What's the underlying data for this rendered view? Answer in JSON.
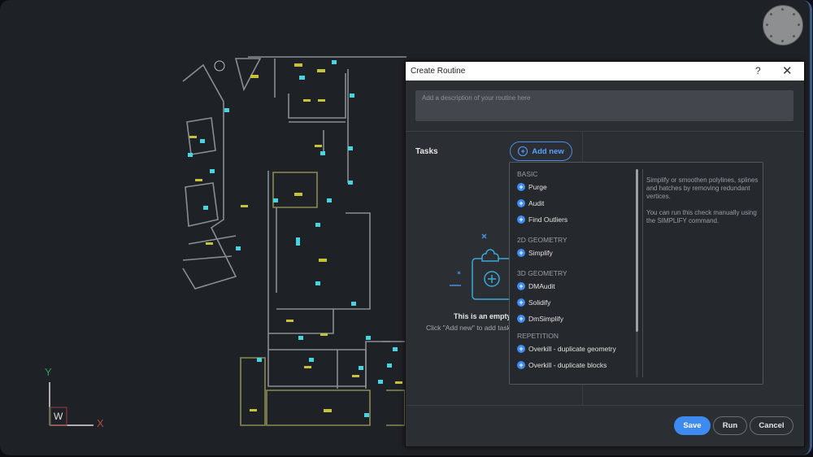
{
  "canvas": {
    "ucs": {
      "y_label": "Y",
      "x_label": "X",
      "w_label": "W"
    },
    "colors": {
      "background": "#1e2126",
      "walls": "#9a9da2",
      "labels": "#c8c23a",
      "symbols": "#46d4e0"
    }
  },
  "dialog": {
    "title": "Create Routine",
    "help_label": "?",
    "close_label": "✕",
    "description_placeholder": "Add a description of your routine here",
    "tasks_label": "Tasks",
    "add_new_label": "Add new",
    "empty_title": "This is an empty",
    "empty_subtitle": "Click \"Add new\" to add task",
    "dropdown": {
      "categories": [
        {
          "label": "BASIC",
          "items": [
            {
              "label": "Purge"
            },
            {
              "label": "Audit"
            },
            {
              "label": "Find Outliers"
            }
          ]
        },
        {
          "label": "2D GEOMETRY",
          "items": [
            {
              "label": "Simplify"
            }
          ]
        },
        {
          "label": "3D GEOMETRY",
          "items": [
            {
              "label": "DMAudit"
            },
            {
              "label": "Solidify"
            },
            {
              "label": "DmSimplify"
            }
          ]
        },
        {
          "label": "REPETITION",
          "items": [
            {
              "label": "Overkill - duplicate geometry"
            },
            {
              "label": "Overkill - duplicate blocks"
            }
          ]
        }
      ],
      "description_1": "Simplify or smoothen polylines, splines and hatches by removing redundant vertices.",
      "description_2": "You can run this check manually using the SIMPLIFY command."
    },
    "buttons": {
      "save": "Save",
      "run": "Run",
      "cancel": "Cancel"
    },
    "accent_color": "#3d8bf0"
  }
}
